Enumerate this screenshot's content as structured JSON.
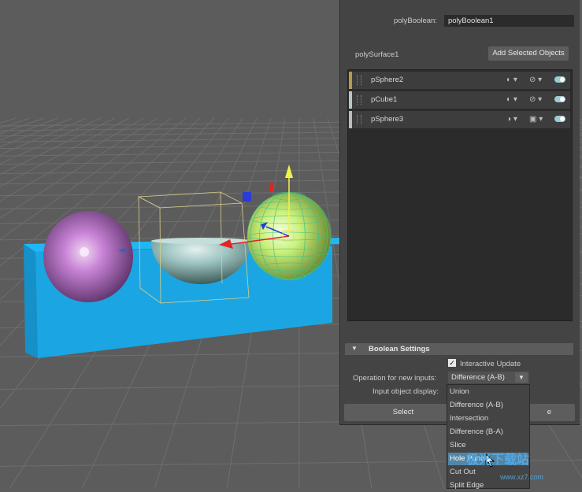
{
  "colors": {
    "viewport_bg": "#5d5d5d",
    "grid": "#6c6c6c",
    "cube": "#19a8e6",
    "sphere_purple": "#c07ad0",
    "sphere_green": "#c7f57a",
    "hemisphere": "#9fc6c2",
    "panel_bg": "#444444",
    "selected_option": "#5285a6"
  },
  "scene": {
    "objects": [
      "purple-sphere",
      "hemisphere",
      "green-sphere",
      "blue-cube"
    ]
  },
  "attribute_editor": {
    "node_label": "polyBoolean:",
    "node_value": "polyBoolean1",
    "surface_label": "polySurface1",
    "add_button": "Add Selected Objects",
    "inputs": [
      {
        "name": "pSphere2",
        "color": "#b99a4a",
        "op_icon": "intersect-icon",
        "vis_icon": "eye-hidden-icon"
      },
      {
        "name": "pCube1",
        "color": "#b8c7c5",
        "op_icon": "intersect-icon",
        "vis_icon": "eye-hidden-icon"
      },
      {
        "name": "pSphere3",
        "color": "#bcbcbc",
        "op_icon": "subtract-icon",
        "vis_icon": "box-icon"
      }
    ],
    "settings": {
      "title": "Boolean Settings",
      "interactive_update_label": "Interactive Update",
      "interactive_update_checked": true,
      "operation_label": "Operation for new inputs:",
      "operation_value": "Difference (A-B)",
      "display_label": "Input object display:",
      "select_button": "Select",
      "partial_button": "e"
    },
    "dropdown_options": [
      "Union",
      "Difference (A-B)",
      "Intersection",
      "Difference (B-A)",
      "Slice",
      "Hole Punch",
      "Cut Out",
      "Split Edge"
    ],
    "dropdown_selected": "Hole Punch"
  },
  "watermark": {
    "text": "极光下载站",
    "url": "www.xz7.com"
  }
}
